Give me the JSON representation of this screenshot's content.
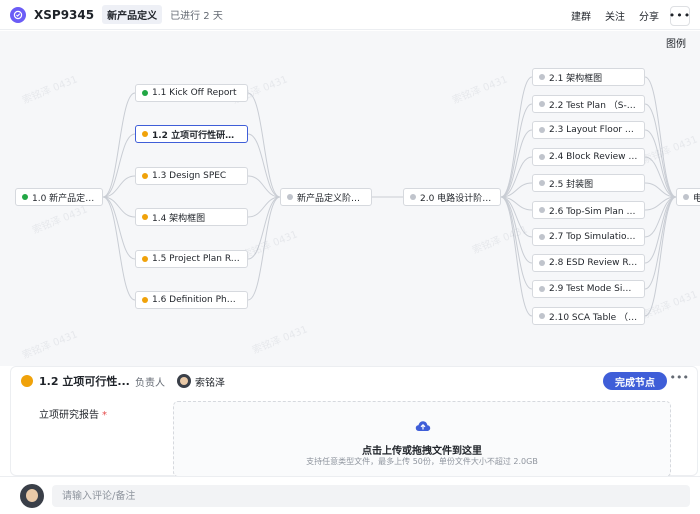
{
  "header": {
    "project_id": "XSP9345",
    "stage": "新产品定义",
    "progress": "已进行 2 天",
    "actions": {
      "group": "建群",
      "follow": "关注",
      "share": "分享",
      "more": "•••"
    }
  },
  "canvas": {
    "legend": "图例",
    "watermark": "索铭泽 0431"
  },
  "flow": {
    "start": {
      "label": "1.0 新产品定义开始",
      "status": "done"
    },
    "phase1_tasks": [
      {
        "label": "1.1 Kick Off Report",
        "status": "done"
      },
      {
        "label": "1.2 立项可行性研究报告",
        "status": "in-progress",
        "selected": true
      },
      {
        "label": "1.3 Design SPEC",
        "status": "in-progress"
      },
      {
        "label": "1.4 架构框图",
        "status": "in-progress"
      },
      {
        "label": "1.5 Project Plan Review",
        "status": "in-progress"
      },
      {
        "label": "1.6 Definition Phase Rel...",
        "status": "in-progress"
      }
    ],
    "phase1_end": {
      "label": "新产品定义阶段结束",
      "status": "pending"
    },
    "phase2_start": {
      "label": "2.0 电路设计阶段开始",
      "status": "pending"
    },
    "phase2_tasks": [
      {
        "label": "2.1 架构框图",
        "status": "pending"
      },
      {
        "label": "2.2 Test Plan （S-RD-...",
        "status": "pending"
      },
      {
        "label": "2.3 Layout Floor Plan",
        "status": "pending"
      },
      {
        "label": "2.4 Block Review Repor...",
        "status": "pending"
      },
      {
        "label": "2.5 封装图",
        "status": "pending"
      },
      {
        "label": "2.6 Top-Sim Plan （S-...",
        "status": "pending"
      },
      {
        "label": "2.7 Top Simulation Repo...",
        "status": "pending"
      },
      {
        "label": "2.8 ESD Review Report ...",
        "status": "pending"
      },
      {
        "label": "2.9 Test Mode Simulati...",
        "status": "pending"
      },
      {
        "label": "2.10 SCA Table （S-R...",
        "status": "pending"
      }
    ],
    "next_partial": {
      "label": "电",
      "status": "pending"
    }
  },
  "detail": {
    "title": "1.2 立项可行性...",
    "owner_label": "负责人",
    "owner_name": "索铭泽",
    "complete_button": "完成节点",
    "more": "•••",
    "field_label": "立项研究报告",
    "required_mark": "*",
    "upload_main": "点击上传或拖拽文件到这里",
    "upload_sub": "支持任意类型文件，最多上传 50份，单份文件大小不超过 2.0GB"
  },
  "comment": {
    "placeholder": "请输入评论/备注"
  },
  "colors": {
    "accent": "#3f5ed8",
    "done": "#22a745",
    "in_progress": "#f0a20a",
    "pending": "#c0c4cc",
    "project_icon": "#6b5cf6"
  }
}
